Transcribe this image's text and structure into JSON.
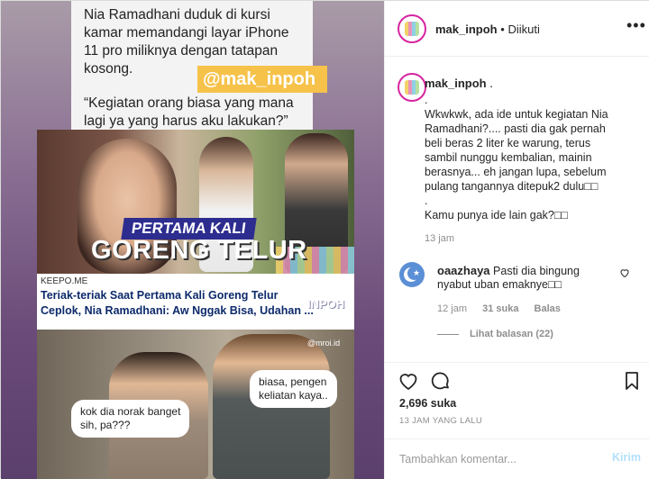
{
  "post": {
    "caption_lines": [
      "Nia Ramadhani duduk di kursi",
      "kamar memandangi layar iPhone",
      "11 pro miliknya dengan tatapan",
      "kosong."
    ],
    "quote_lines": [
      "“Kegiatan orang biasa yang mana",
      "lagi ya yang harus aku lakukan?”"
    ],
    "watermark": "@mak_inpoh",
    "article": {
      "badge": "PERTAMA KALI",
      "headline": "GORENG TELUR",
      "site": "KEEPO.ME",
      "title_lines": [
        "Teriak-teriak Saat Pertama Kali Goreng Telur",
        "Ceplok, Nia Ramadhani: Aw Nggak Bisa, Udahan ..."
      ],
      "mark": "INPOH"
    },
    "meme": {
      "source": "@mroi.id",
      "bubble_left": [
        "kok dia norak banget",
        "sih, pa???"
      ],
      "bubble_right": [
        "biasa, pengen",
        "keliatan kaya.."
      ]
    }
  },
  "header": {
    "username": "mak_inpoh",
    "separator": "•",
    "follow_status": "Diikuti"
  },
  "caption": {
    "username": "mak_inpoh",
    "suffix": ".",
    "lines": [
      ".",
      "Wkwkwk, ada ide untuk kegiatan Nia",
      "Ramadhani?.... pasti dia gak pernah",
      "beli beras 2 liter ke warung, terus",
      "sambil nunggu kembalian, mainin",
      "berasnya... eh jangan lupa, sebelum",
      "pulang tangannya ditepuk2 dulu□□",
      ".",
      "Kamu punya ide lain gak?□□"
    ],
    "time": "13 jam"
  },
  "comment": {
    "username": "oaazhaya",
    "text_line1": "Pasti dia bingung",
    "text_line2": "nyabut uban emaknye□□",
    "time": "12 jam",
    "likes": "31 suka",
    "reply": "Balas",
    "view_replies": "Lihat balasan (22)"
  },
  "actions": {
    "likes": "2,696 suka",
    "timestamp": "13 JAM YANG LALU"
  },
  "comment_box": {
    "placeholder": "Tambahkan komentar...",
    "post_label": "Kirim"
  }
}
